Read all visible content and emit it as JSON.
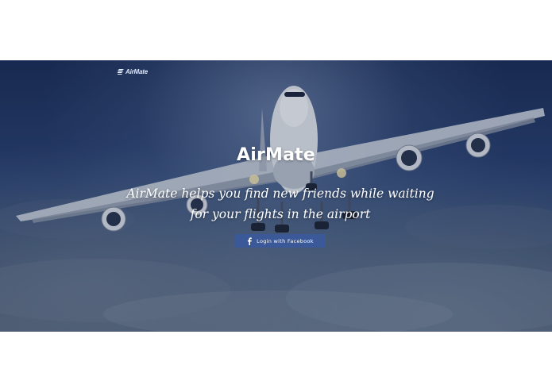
{
  "header": {
    "brand_name": "AirMate",
    "brand_icon": "airmate-logo-icon"
  },
  "hero": {
    "title": "AirMate",
    "tagline": "AirMate helps you find new friends while waiting for your flights in the airport",
    "background_image": "airplane-in-cloudy-sky"
  },
  "cta": {
    "facebook_label": "Login with Facebook",
    "facebook_icon": "facebook-icon"
  },
  "colors": {
    "facebook_blue": "#3b5998",
    "text": "#ffffff",
    "sky_dark": "#1c2e58"
  }
}
